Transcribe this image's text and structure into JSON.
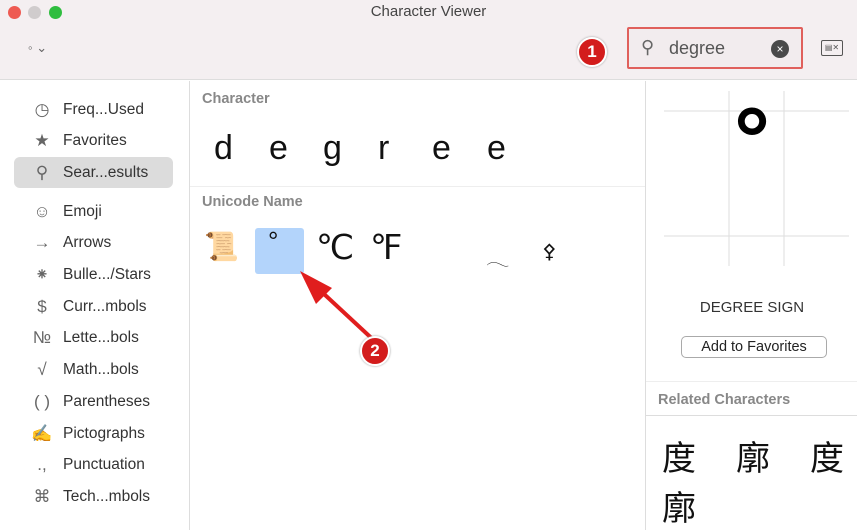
{
  "window": {
    "title": "Character Viewer",
    "traffic_lights": [
      "#ee5a52",
      "#d0cccd",
      "#2fbd3f"
    ]
  },
  "toolbar": {
    "view_selector": "◦ ⌄",
    "search_value": "degree",
    "search_icon": "magnifier-icon",
    "clear_icon": "×",
    "keyboard_viewer_icon": "▤✕"
  },
  "annotations": [
    "1",
    "2"
  ],
  "sidebar": {
    "items": [
      {
        "icon": "◷",
        "label": "Freq...Used"
      },
      {
        "icon": "★",
        "label": "Favorites"
      },
      {
        "icon": "⚲",
        "label": "Sear...esults",
        "selected": true
      },
      {
        "icon": "☺",
        "label": "Emoji"
      },
      {
        "icon": "→",
        "label": "Arrows"
      },
      {
        "icon": "⁕",
        "label": "Bulle.../Stars"
      },
      {
        "icon": "$",
        "label": "Curr...mbols"
      },
      {
        "icon": "№",
        "label": "Lette...bols"
      },
      {
        "icon": "√",
        "label": "Math...bols"
      },
      {
        "icon": "( )",
        "label": "Parentheses"
      },
      {
        "icon": "✍",
        "label": "Pictographs"
      },
      {
        "icon": ".,",
        "label": "Punctuation"
      },
      {
        "icon": "⌘",
        "label": "Tech...mbols"
      }
    ]
  },
  "main": {
    "character_header": "Character",
    "characters": [
      "d",
      "e",
      "g",
      "r",
      "e",
      "e"
    ],
    "unicode_header": "Unicode Name",
    "results": [
      "📜",
      "°",
      "℃",
      "℉",
      "𓂃",
      "⚴"
    ]
  },
  "detail": {
    "preview": "°",
    "name": "DEGREE SIGN",
    "add_favorites": "Add to Favorites",
    "related_header": "Related Characters",
    "related": [
      "度",
      "廓",
      "度",
      "廓"
    ]
  }
}
